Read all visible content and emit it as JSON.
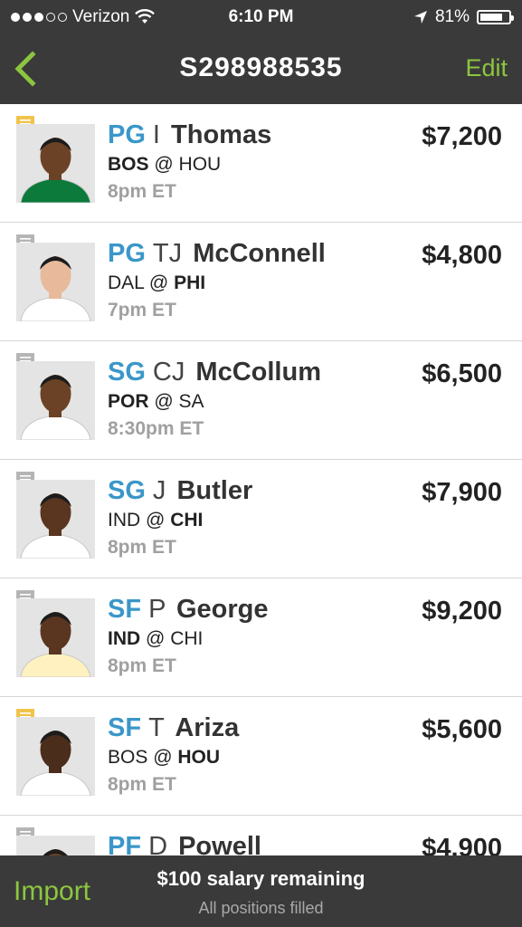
{
  "status_bar": {
    "carrier": "Verizon",
    "time": "6:10 PM",
    "battery": "81%",
    "battery_level": 0.81,
    "signal_bars_filled": 3,
    "signal_bars_total": 5,
    "icons": [
      "wifi-icon",
      "location-arrow-icon",
      "battery-icon"
    ]
  },
  "nav": {
    "title": "S298988535",
    "edit_label": "Edit",
    "back_icon": "chevron-left-icon"
  },
  "colors": {
    "accent_green": "#8cc63f",
    "position_blue": "#3a97c9",
    "bar_dark": "#3a3a3a",
    "note_active": "#f0c34a",
    "note_inactive": "#b5b5b5"
  },
  "players": [
    {
      "position": "PG",
      "first": "I",
      "last": "Thomas",
      "salary": "$7,200",
      "away": "BOS",
      "at": "@",
      "home": "HOU",
      "team_side": "away",
      "time": "8pm ET",
      "note_active": true,
      "jersey": "#0b7a3b",
      "skin": "#6b4226"
    },
    {
      "position": "PG",
      "first": "TJ",
      "last": "McConnell",
      "salary": "$4,800",
      "away": "DAL",
      "at": "@",
      "home": "PHI",
      "team_side": "home",
      "time": "7pm ET",
      "note_active": false,
      "jersey": "#ffffff",
      "skin": "#e8b99a"
    },
    {
      "position": "SG",
      "first": "CJ",
      "last": "McCollum",
      "salary": "$6,500",
      "away": "POR",
      "at": "@",
      "home": "SA",
      "team_side": "away",
      "time": "8:30pm ET",
      "note_active": false,
      "jersey": "#ffffff",
      "skin": "#6b4226"
    },
    {
      "position": "SG",
      "first": "J",
      "last": "Butler",
      "salary": "$7,900",
      "away": "IND",
      "at": "@",
      "home": "CHI",
      "team_side": "home",
      "time": "8pm ET",
      "note_active": false,
      "jersey": "#ffffff",
      "skin": "#5a3520"
    },
    {
      "position": "SF",
      "first": "P",
      "last": "George",
      "salary": "$9,200",
      "away": "IND",
      "at": "@",
      "home": "CHI",
      "team_side": "away",
      "time": "8pm ET",
      "note_active": false,
      "jersey": "#fff2c0",
      "skin": "#5a3520"
    },
    {
      "position": "SF",
      "first": "T",
      "last": "Ariza",
      "salary": "$5,600",
      "away": "BOS",
      "at": "@",
      "home": "HOU",
      "team_side": "home",
      "time": "8pm ET",
      "note_active": true,
      "jersey": "#ffffff",
      "skin": "#4a2d1a"
    },
    {
      "position": "PF",
      "first": "D",
      "last": "Powell",
      "salary": "$4,900",
      "away": "",
      "at": "",
      "home": "",
      "team_side": "away",
      "time": "",
      "note_active": false,
      "jersey": "#ffffff",
      "skin": "#6b4226"
    }
  ],
  "bottom": {
    "import_label": "Import",
    "salary_remaining": "$100 salary remaining",
    "positions_status": "All positions filled"
  }
}
